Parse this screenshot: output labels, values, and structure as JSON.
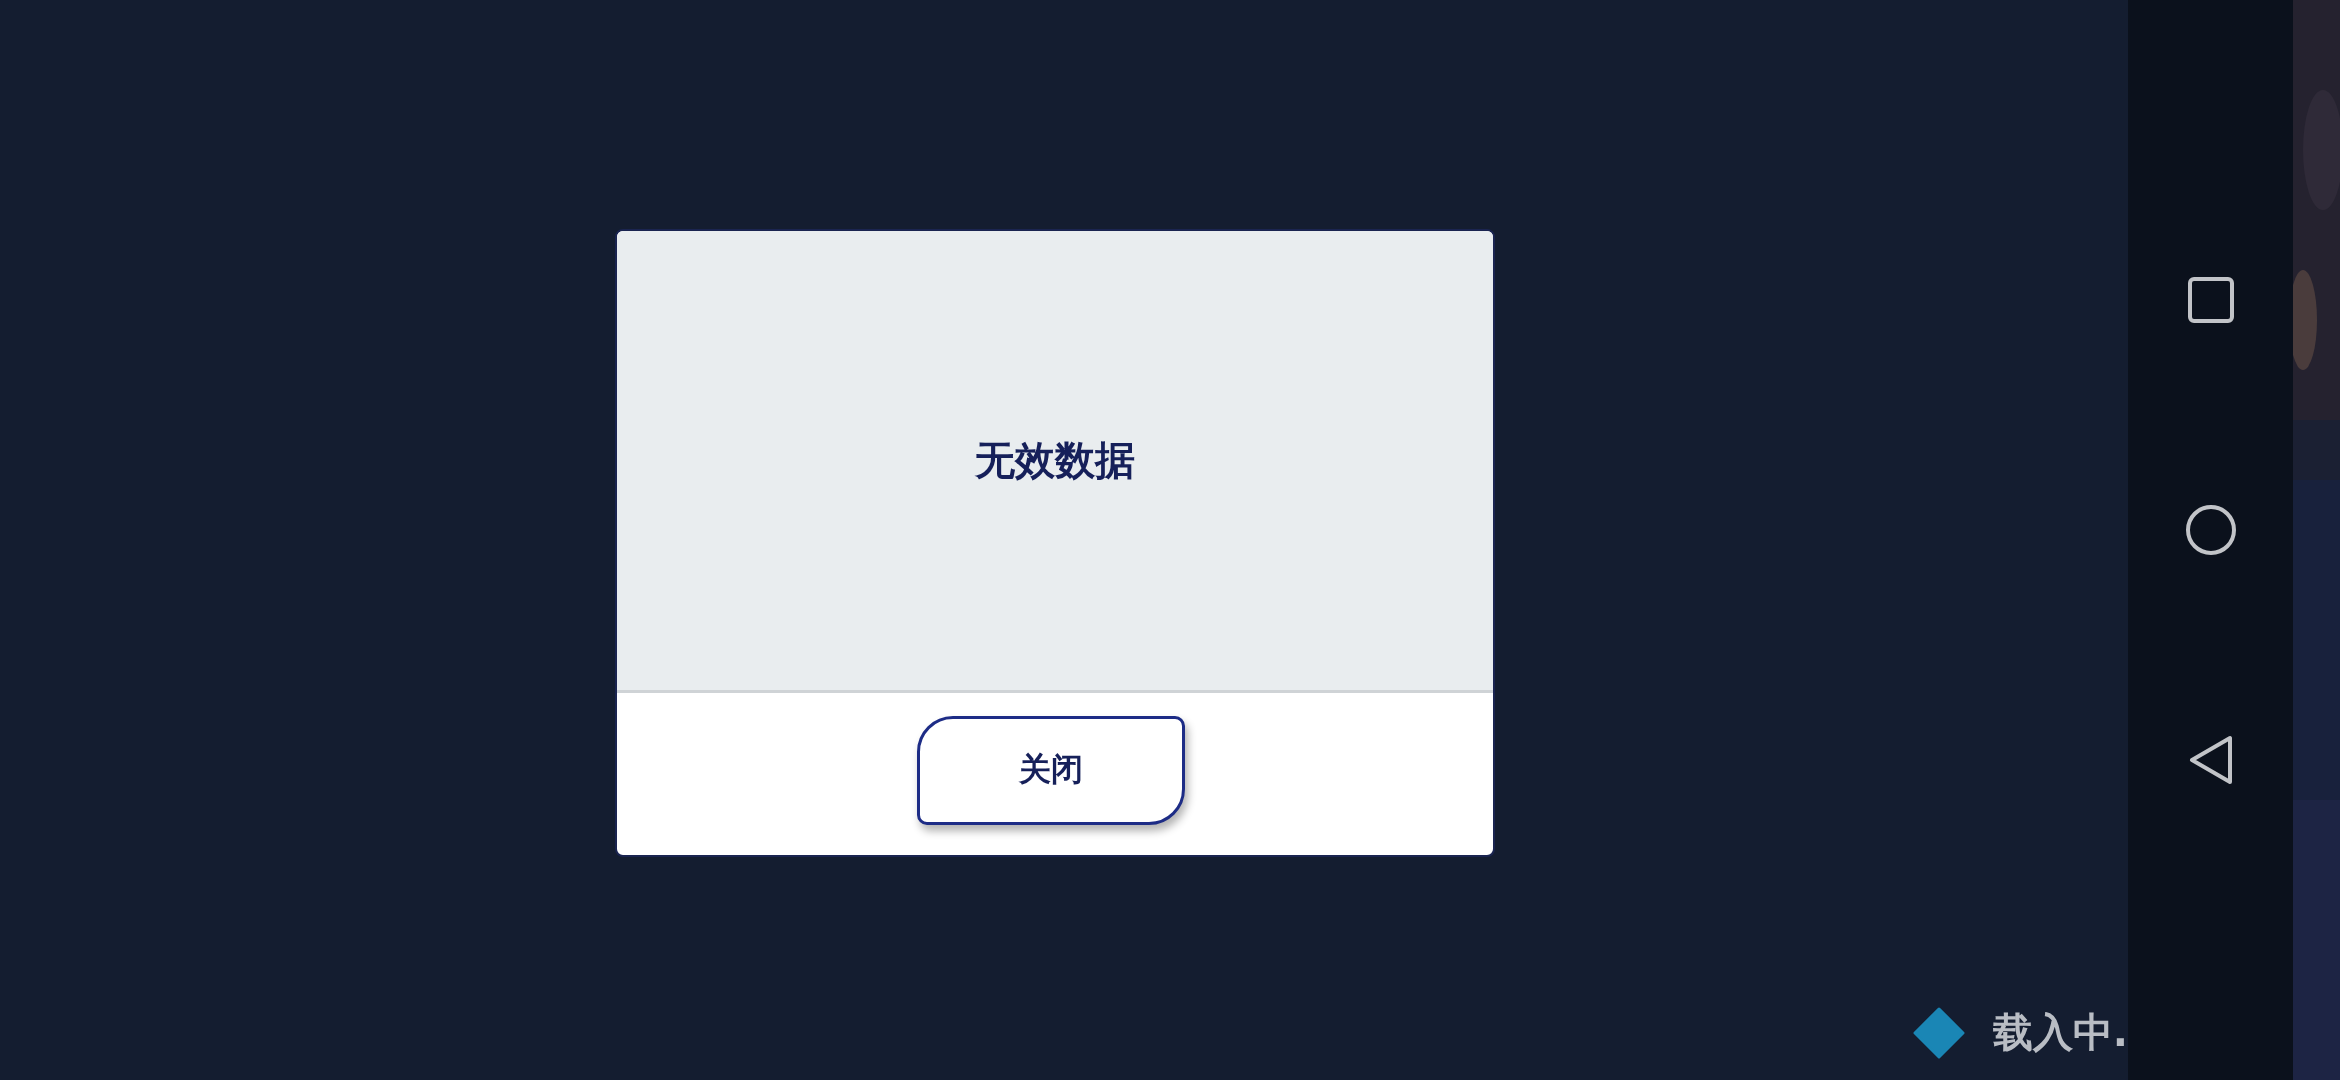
{
  "dialog": {
    "message": "无效数据",
    "buttons": [
      "关闭"
    ]
  },
  "loading": {
    "text": "载入中."
  },
  "nav_bar": {
    "buttons": [
      {
        "kind": "recents"
      },
      {
        "kind": "home"
      },
      {
        "kind": "back"
      }
    ]
  }
}
